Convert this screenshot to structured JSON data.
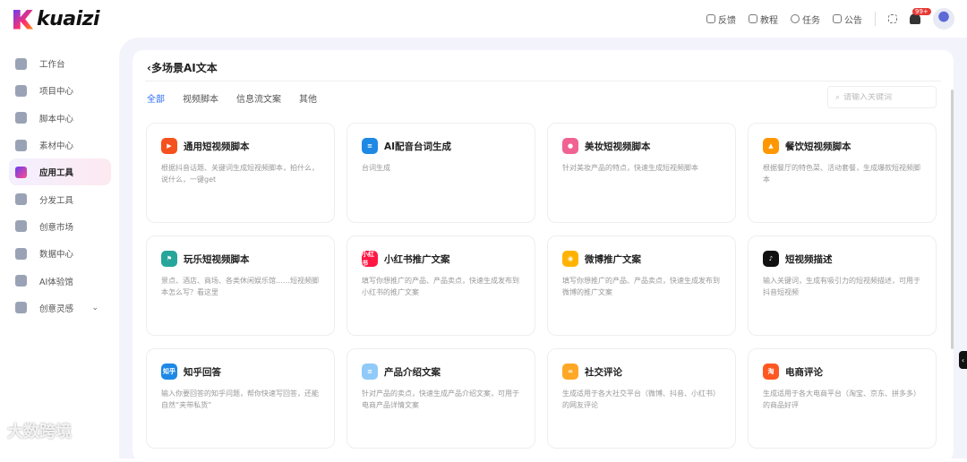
{
  "brand": "kuaizi",
  "topnav": {
    "items": [
      "反馈",
      "教程",
      "任务",
      "公告"
    ],
    "badge": "99+"
  },
  "sidebar": {
    "items": [
      {
        "label": "工作台"
      },
      {
        "label": "项目中心"
      },
      {
        "label": "脚本中心"
      },
      {
        "label": "素材中心"
      },
      {
        "label": "应用工具",
        "active": true
      },
      {
        "label": "分发工具"
      },
      {
        "label": "创意市场"
      },
      {
        "label": "数据中心"
      },
      {
        "label": "AI体验馆"
      },
      {
        "label": "创意灵感"
      }
    ]
  },
  "page": {
    "title": "多场景AI文本",
    "back_icon": "‹",
    "tabs": [
      "全部",
      "视频脚本",
      "信息流文案",
      "其他"
    ],
    "search_placeholder": "请输入关键词"
  },
  "cards": [
    {
      "name": "通用短视频脚本",
      "desc": "根据抖音话题、关键词生成短视频脚本，拍什么，说什么，一键get",
      "color": "#f4511e",
      "glyph": "▶"
    },
    {
      "name": "AI配音台词生成",
      "desc": "台词生成",
      "color": "#1e88e5",
      "glyph": "≡"
    },
    {
      "name": "美妆短视频脚本",
      "desc": "针对美妆产品的特点，快速生成短视频脚本",
      "color": "#f06292",
      "glyph": "●"
    },
    {
      "name": "餐饮短视频脚本",
      "desc": "根据餐厅的特色菜、活动套餐，生成爆款短视频脚本",
      "color": "#ff9800",
      "glyph": "▲"
    },
    {
      "name": "玩乐短视频脚本",
      "desc": "景点、酒店、商场、各类休闲娱乐馆……短视频脚本怎么写？看这里",
      "color": "#26a69a",
      "glyph": "⚑"
    },
    {
      "name": "小红书推广文案",
      "desc": "填写你想推广的产品、产品卖点，快速生成发布到小红书的推广文案",
      "color": "#ff1744",
      "glyph": "小红书"
    },
    {
      "name": "微博推广文案",
      "desc": "填写你想推广的产品、产品卖点，快速生成发布到微博的推广文案",
      "color": "#ffb300",
      "glyph": "◉"
    },
    {
      "name": "短视频描述",
      "desc": "输入关键词，生成有吸引力的短视频描述，可用于抖音短视频",
      "color": "#111111",
      "glyph": "♪"
    },
    {
      "name": "知乎回答",
      "desc": "输入你要回答的知乎问题，帮你快速写回答，还能自然“夹带私货”",
      "color": "#1e88e5",
      "glyph": "知乎"
    },
    {
      "name": "产品介绍文案",
      "desc": "针对产品的卖点，快速生成产品介绍文案，可用于电商产品详情文案",
      "color": "#90caf9",
      "glyph": "≡"
    },
    {
      "name": "社交评论",
      "desc": "生成适用于各大社交平台（微博、抖音、小红书）的网友评论",
      "color": "#ffa726",
      "glyph": "="
    },
    {
      "name": "电商评论",
      "desc": "生成适用于各大电商平台（淘宝、京东、拼多多）的商品好评",
      "color": "#ff5722",
      "glyph": "淘"
    }
  ],
  "watermark": "大数跨境"
}
